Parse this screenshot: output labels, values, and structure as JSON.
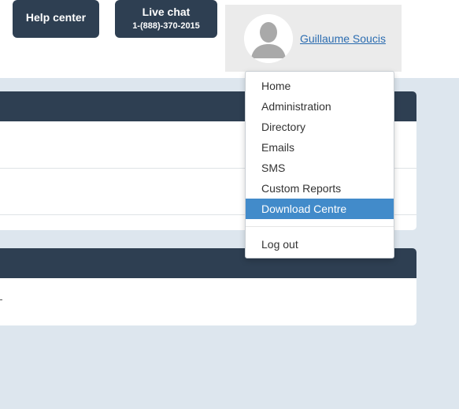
{
  "header": {
    "help_label": "Help center",
    "chat_label": "Live chat",
    "chat_phone": "1-(888)-370-2015",
    "user_name": "Guillaume Soucis"
  },
  "menu": {
    "items": [
      {
        "label": "Home"
      },
      {
        "label": "Administration"
      },
      {
        "label": "Directory"
      },
      {
        "label": "Emails"
      },
      {
        "label": "SMS"
      },
      {
        "label": "Custom Reports"
      },
      {
        "label": "Download Centre",
        "active": true
      }
    ],
    "logout_label": "Log out"
  },
  "colors": {
    "header_dark": "#2e3f52",
    "menu_active": "#428bca",
    "link": "#2b6cb0",
    "page_bg": "#dde6ee"
  },
  "icons": {
    "avatar": "default-user-silhouette"
  }
}
